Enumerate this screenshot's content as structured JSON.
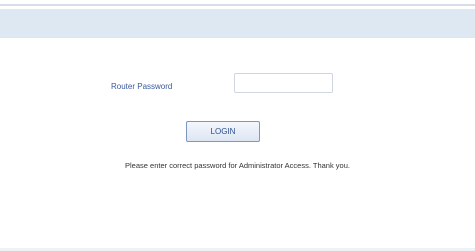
{
  "form": {
    "password_label": "Router Password",
    "password_value": "",
    "login_label": "LOGIN"
  },
  "notice": {
    "text": "Please enter correct password for Administrator Access. Thank you."
  }
}
